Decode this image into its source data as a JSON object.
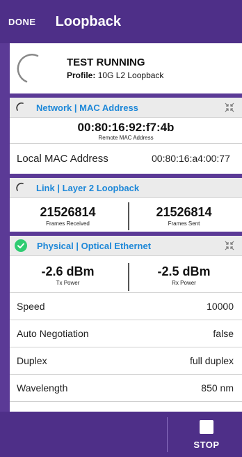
{
  "header": {
    "done_label": "DONE",
    "title": "Loopback"
  },
  "status": {
    "state": "TEST RUNNING",
    "profile_label": "Profile:",
    "profile_value": "10G L2 Loopback"
  },
  "network": {
    "title": "Network | MAC Address",
    "remote_mac": "00:80:16:92:f7:4b",
    "remote_mac_label": "Remote MAC Address",
    "local_mac_label": "Local MAC Address",
    "local_mac_value": "00:80:16:a4:00:77"
  },
  "link": {
    "title": "Link | Layer 2 Loopback",
    "frames_received": "21526814",
    "frames_received_label": "Frames Received",
    "frames_sent": "21526814",
    "frames_sent_label": "Frames Sent"
  },
  "physical": {
    "title": "Physical | Optical Ethernet",
    "tx_power": "-2.6 dBm",
    "tx_power_label": "Tx Power",
    "rx_power": "-2.5 dBm",
    "rx_power_label": "Rx Power",
    "params": [
      {
        "label": "Speed",
        "value": "10000"
      },
      {
        "label": "Auto Negotiation",
        "value": "false"
      },
      {
        "label": "Duplex",
        "value": "full duplex"
      },
      {
        "label": "Wavelength",
        "value": "850 nm"
      }
    ]
  },
  "footer": {
    "stop_label": "STOP"
  },
  "colors": {
    "primary_purple": "#4e2f88",
    "section_title_blue": "#1e88d8",
    "ok_green": "#2ecc71"
  },
  "icons": [
    "spinner-icon",
    "collapse-icon",
    "check-circle-icon",
    "stop-icon"
  ]
}
